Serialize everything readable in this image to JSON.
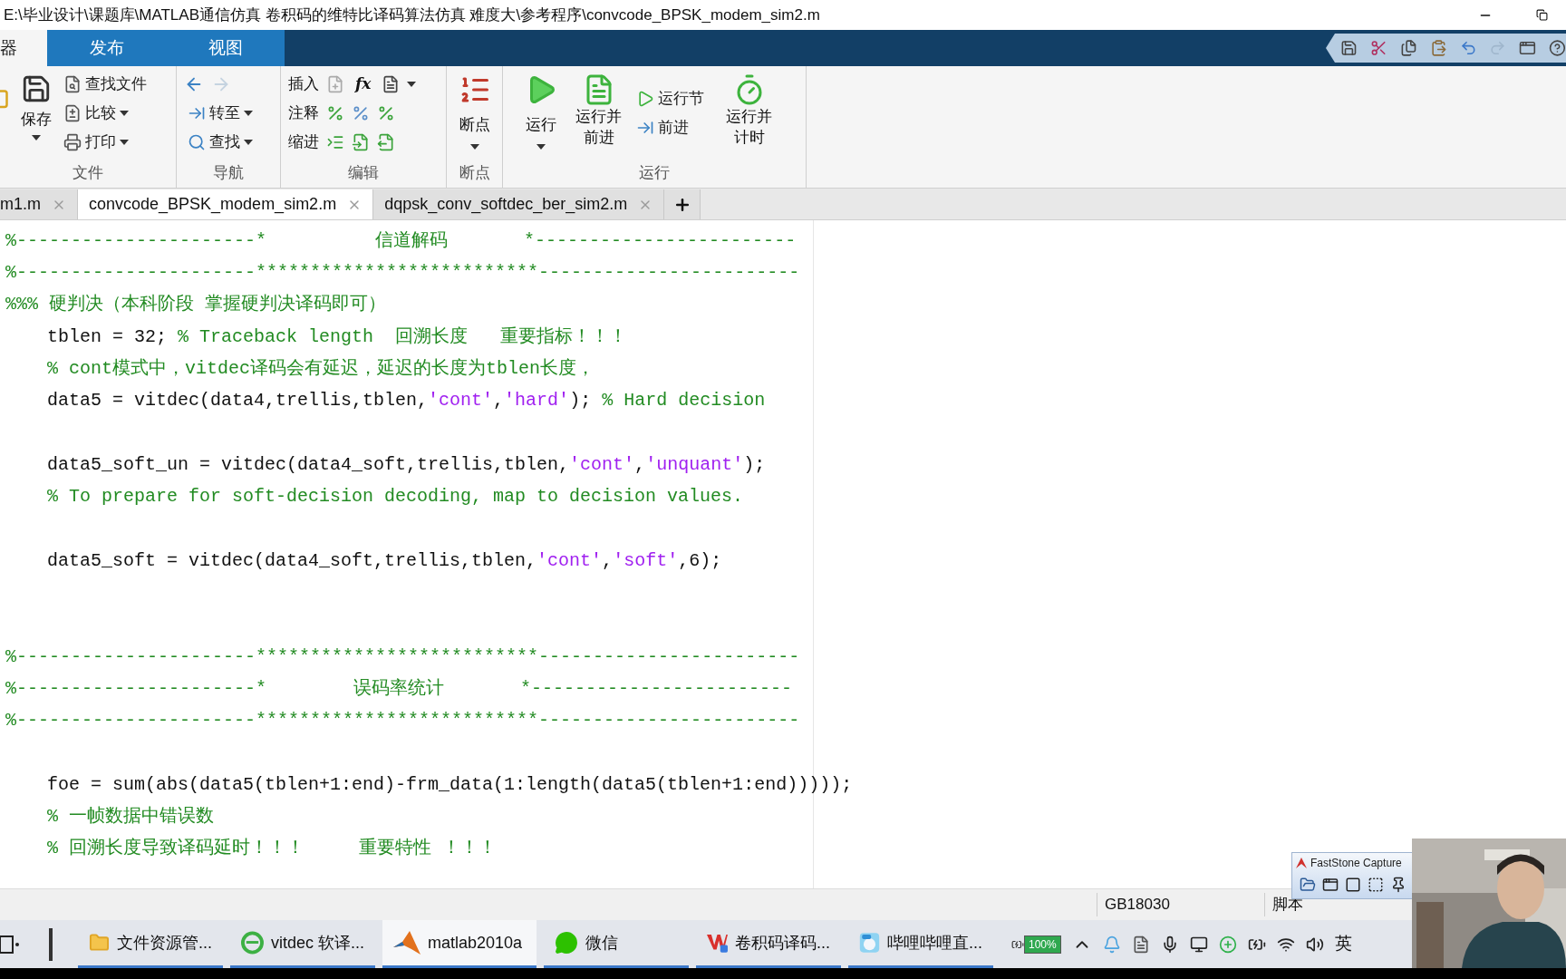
{
  "title_bar": {
    "title": "E:\\毕业设计\\课题库\\MATLAB通信仿真 卷积码的维特比译码算法仿真 难度大\\参考程序\\convcode_BPSK_modem_sim2.m"
  },
  "quick_access": {
    "redo_disabled": true
  },
  "ribbon_tabs": [
    {
      "label": "器",
      "selected": true
    },
    {
      "label": "发布",
      "selected": false
    },
    {
      "label": "视图",
      "selected": false
    }
  ],
  "ribbon": {
    "file": {
      "label": "文件",
      "save": "保存",
      "find_files": "查找文件",
      "compare": "比较",
      "print": "打印"
    },
    "navigate": {
      "label": "导航",
      "back_disabled": false,
      "forward_disabled": true,
      "go_to": "转至",
      "find": "查找"
    },
    "edit": {
      "label": "编辑",
      "insert": "插入",
      "fx": "fx",
      "comment": "注释",
      "indent": "缩进"
    },
    "breakpoints": {
      "label": "断点",
      "button": "断点"
    },
    "run": {
      "label": "运行",
      "run": "运行",
      "run_advance": [
        "运行并",
        "前进"
      ],
      "run_section": "运行节",
      "advance": "前进",
      "run_time": [
        "运行并",
        "计时"
      ]
    }
  },
  "editor_tabs": [
    {
      "label": "m1.m",
      "selected": false
    },
    {
      "label": "convcode_BPSK_modem_sim2.m",
      "selected": true
    },
    {
      "label": "dqpsk_conv_softdec_ber_sim2.m",
      "selected": false
    }
  ],
  "code_lines": [
    {
      "kind": "code",
      "indented": false,
      "segments": [
        {
          "kind": "comment",
          "text": "%----------------------*          信道解码       *------------------------"
        }
      ]
    },
    {
      "kind": "code",
      "indented": false,
      "segments": [
        {
          "kind": "comment",
          "text": "%----------------------**************************------------------------"
        }
      ]
    },
    {
      "kind": "code",
      "indented": false,
      "segments": [
        {
          "kind": "comment",
          "text": "%%% 硬判决（本科阶段 掌握硬判决译码即可）"
        }
      ]
    },
    {
      "kind": "code",
      "indented": true,
      "segments": [
        {
          "kind": "code",
          "text": "tblen = 32; "
        },
        {
          "kind": "comment",
          "text": "% Traceback length  回溯长度   重要指标！！！"
        }
      ]
    },
    {
      "kind": "code",
      "indented": true,
      "segments": [
        {
          "kind": "comment",
          "text": "% cont模式中，vitdec译码会有延迟，延迟的长度为tblen长度，"
        }
      ]
    },
    {
      "kind": "code",
      "indented": true,
      "segments": [
        {
          "kind": "code",
          "text": "data5 = vitdec(data4,trellis,tblen,"
        },
        {
          "kind": "string",
          "text": "'cont'"
        },
        {
          "kind": "code",
          "text": ","
        },
        {
          "kind": "string",
          "text": "'hard'"
        },
        {
          "kind": "code",
          "text": "); "
        },
        {
          "kind": "comment",
          "text": "% Hard decision"
        }
      ]
    },
    {
      "kind": "blank"
    },
    {
      "kind": "code",
      "indented": true,
      "segments": [
        {
          "kind": "code",
          "text": "data5_soft_un = vitdec(data4_soft,trellis,tblen,"
        },
        {
          "kind": "string",
          "text": "'cont'"
        },
        {
          "kind": "code",
          "text": ","
        },
        {
          "kind": "string",
          "text": "'unquant'"
        },
        {
          "kind": "code",
          "text": ");"
        }
      ]
    },
    {
      "kind": "code",
      "indented": true,
      "segments": [
        {
          "kind": "comment",
          "text": "% To prepare for soft-decision decoding, map to decision values."
        }
      ]
    },
    {
      "kind": "blank"
    },
    {
      "kind": "code",
      "indented": true,
      "segments": [
        {
          "kind": "code",
          "text": "data5_soft = vitdec(data4_soft,trellis,tblen,"
        },
        {
          "kind": "string",
          "text": "'cont'"
        },
        {
          "kind": "code",
          "text": ","
        },
        {
          "kind": "string",
          "text": "'soft'"
        },
        {
          "kind": "code",
          "text": ",6);"
        }
      ]
    },
    {
      "kind": "blank"
    },
    {
      "kind": "blank"
    },
    {
      "kind": "code",
      "indented": false,
      "segments": [
        {
          "kind": "comment",
          "text": "%----------------------**************************------------------------"
        }
      ]
    },
    {
      "kind": "code",
      "indented": false,
      "segments": [
        {
          "kind": "comment",
          "text": "%----------------------*        误码率统计       *------------------------"
        }
      ]
    },
    {
      "kind": "code",
      "indented": false,
      "segments": [
        {
          "kind": "comment",
          "text": "%----------------------**************************------------------------"
        }
      ]
    },
    {
      "kind": "blank"
    },
    {
      "kind": "code",
      "indented": true,
      "segments": [
        {
          "kind": "code",
          "text": "foe = sum(abs(data5(tblen+1:end)-frm_data(1:length(data5(tblen+1:end)))));"
        }
      ]
    },
    {
      "kind": "code",
      "indented": true,
      "segments": [
        {
          "kind": "comment",
          "text": "% 一帧数据中错误数"
        }
      ]
    },
    {
      "kind": "code",
      "indented": true,
      "segments": [
        {
          "kind": "comment",
          "text": "% 回溯长度导致译码延时！！！     重要特性 ！！！"
        }
      ]
    }
  ],
  "status_bar": {
    "encoding": "GB18030",
    "file_type": "脚本"
  },
  "faststone": {
    "title": "FastStone Capture"
  },
  "taskbar": {
    "apps": [
      {
        "label": "文件资源管...",
        "selected": false
      },
      {
        "label": "vitdec 软译...",
        "selected": false
      },
      {
        "label": "matlab2010a",
        "selected": true
      },
      {
        "label": "微信",
        "selected": false
      },
      {
        "label": "卷积码译码...",
        "selected": false
      },
      {
        "label": "哔哩哔哩直...",
        "selected": false
      }
    ],
    "battery": "100%",
    "ime": "英"
  }
}
